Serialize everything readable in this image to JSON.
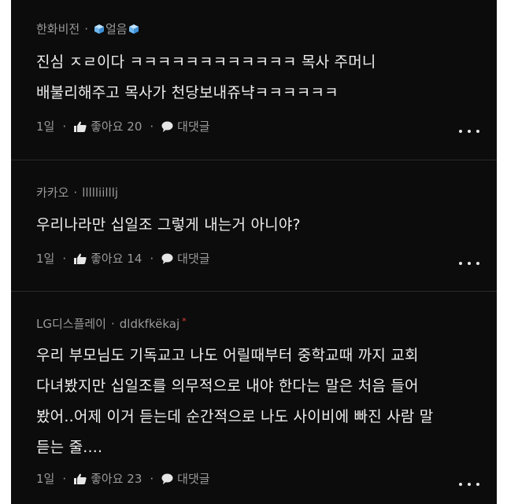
{
  "comments": [
    {
      "author": "한화비전",
      "nickname": "얼음",
      "lines": [
        "진심 ㅈㄹ이다 ㅋㅋㅋㅋㅋㅋㅋㅋㅋㅋㅋㅋ 목사 주머니",
        "배불리해주고 목사가 천당보내쥬냑ㅋㅋㅋㅋㅋㅋ"
      ],
      "time": "1일",
      "like_label": "좋아요 20",
      "reply_label": "대댓글"
    },
    {
      "author": "카카오",
      "nickname": "llllliilllj",
      "lines": [
        "우리나라만 십일조 그렇게 내는거 아니야?"
      ],
      "time": "1일",
      "like_label": "좋아요 14",
      "reply_label": "대댓글"
    },
    {
      "author": "LG디스플레이",
      "nickname": "dldkfkëkaj",
      "badge": "*",
      "lines": [
        "우리 부모님도 기독교고 나도 어릴때부터 중학교때 까지 교회",
        "다녀봤지만 십일조를 의무적으로 내야 한다는 말은 처음 들어",
        "봤어..어제 이거 듣는데 순간적으로 나도 사이비에 빠진 사람 말",
        "듣는 줄...."
      ],
      "time": "1일",
      "like_label": "좋아요 23",
      "reply_label": "대댓글"
    }
  ],
  "separator": "·",
  "colors": {
    "background": "#0c0c0c",
    "text": "#efefef",
    "meta": "#9a9a9a",
    "badge": "#d9413a"
  },
  "icons": {
    "like": "thumbs-up-icon",
    "reply": "speech-bubble-icon",
    "more": "more-dots-icon",
    "emoji": "ice-cube-icon"
  }
}
